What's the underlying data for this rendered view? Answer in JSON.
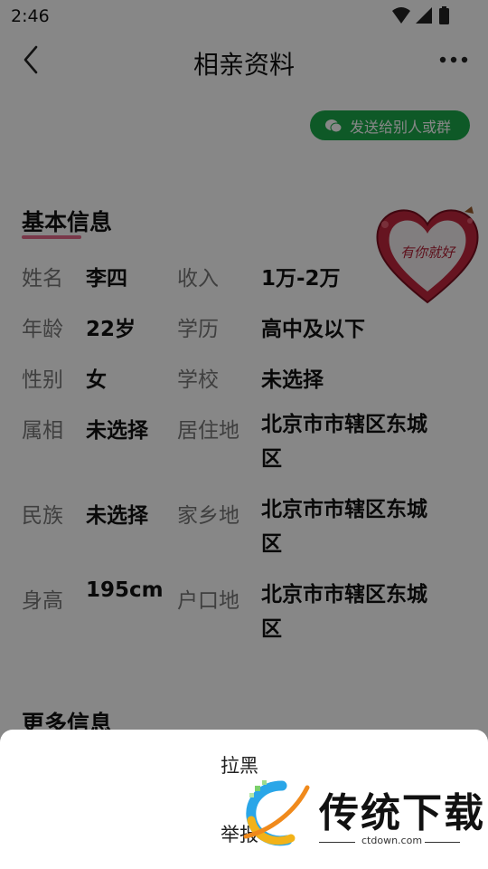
{
  "status_bar": {
    "time": "2:46"
  },
  "header": {
    "title": "相亲资料"
  },
  "share": {
    "label": "发送给别人或群"
  },
  "basic": {
    "title": "基本信息",
    "badge_text": "有你就好",
    "rows": [
      {
        "l1": "姓名",
        "v1": "李四",
        "l2": "收入",
        "v2": "1万-2万"
      },
      {
        "l1": "年龄",
        "v1": "22岁",
        "l2": "学历",
        "v2": "高中及以下"
      },
      {
        "l1": "性别",
        "v1": "女",
        "l2": "学校",
        "v2": "未选择"
      },
      {
        "l1": "属相",
        "v1": "未选择",
        "l2": "居住地",
        "v2": "北京市市辖区东城区"
      },
      {
        "l1": "民族",
        "v1": "未选择",
        "l2": "家乡地",
        "v2": "北京市市辖区东城区"
      },
      {
        "l1": "身高",
        "v1": "195cm",
        "l2": "户口地",
        "v2": "北京市市辖区东城区"
      }
    ]
  },
  "more": {
    "title": "更多信息"
  },
  "sheet": {
    "item1": "拉黑",
    "item2": "举报"
  },
  "watermark": {
    "name": "传统下载",
    "url": "ctdown.com"
  },
  "colors": {
    "accent_green": "#1ba84a",
    "underline_pink": "#e56b8a"
  }
}
